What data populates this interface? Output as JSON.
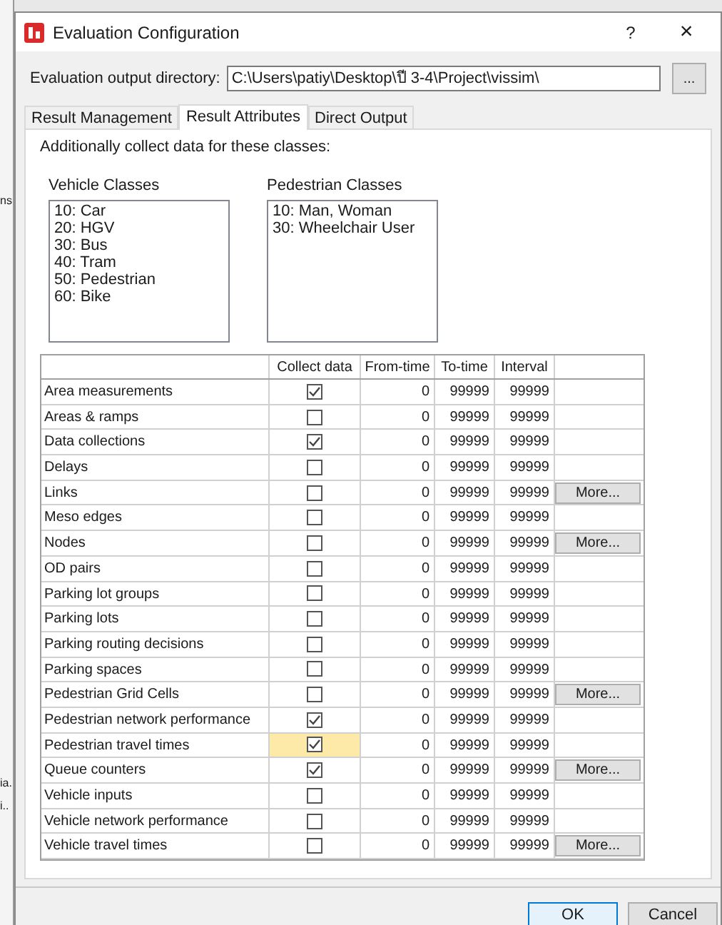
{
  "background_window": {
    "fragments": [
      "ns",
      "ia.",
      "i.."
    ]
  },
  "window": {
    "title": "Evaluation Configuration",
    "help": "?",
    "close": "×"
  },
  "output_directory": {
    "label": "Evaluation output directory:",
    "value": "C:\\Users\\patiy\\Desktop\\ปี 3-4\\Project\\vissim\\",
    "browse": "..."
  },
  "tabs": [
    {
      "label": "Result Management",
      "selected": false
    },
    {
      "label": "Result Attributes",
      "selected": true
    },
    {
      "label": "Direct Output",
      "selected": false
    }
  ],
  "intro": "Additionally collect data for these classes:",
  "vehicle_classes": {
    "title": "Vehicle Classes",
    "items": [
      "10: Car",
      "20: HGV",
      "30: Bus",
      "40: Tram",
      "50: Pedestrian",
      "60: Bike"
    ]
  },
  "pedestrian_classes": {
    "title": "Pedestrian Classes",
    "items": [
      "10: Man, Woman",
      "30: Wheelchair User"
    ]
  },
  "table": {
    "columns": [
      "Collect data",
      "From-time",
      "To-time",
      "Interval"
    ],
    "rows": [
      {
        "name": "Area measurements",
        "checked": true,
        "selected": false,
        "from": "0",
        "to": "99999",
        "interval": "99999"
      },
      {
        "name": "Areas & ramps",
        "checked": false,
        "selected": false,
        "from": "0",
        "to": "99999",
        "interval": "99999"
      },
      {
        "name": "Data collections",
        "checked": true,
        "selected": false,
        "from": "0",
        "to": "99999",
        "interval": "99999"
      },
      {
        "name": "Delays",
        "checked": false,
        "selected": false,
        "from": "0",
        "to": "99999",
        "interval": "99999"
      },
      {
        "name": "Links",
        "checked": false,
        "selected": false,
        "from": "0",
        "to": "99999",
        "interval": "99999",
        "more": "More..."
      },
      {
        "name": "Meso edges",
        "checked": false,
        "selected": false,
        "from": "0",
        "to": "99999",
        "interval": "99999"
      },
      {
        "name": "Nodes",
        "checked": false,
        "selected": false,
        "from": "0",
        "to": "99999",
        "interval": "99999",
        "more": "More..."
      },
      {
        "name": "OD pairs",
        "checked": false,
        "selected": false,
        "from": "0",
        "to": "99999",
        "interval": "99999"
      },
      {
        "name": "Parking lot groups",
        "checked": false,
        "selected": false,
        "from": "0",
        "to": "99999",
        "interval": "99999"
      },
      {
        "name": "Parking lots",
        "checked": false,
        "selected": false,
        "from": "0",
        "to": "99999",
        "interval": "99999"
      },
      {
        "name": "Parking routing decisions",
        "checked": false,
        "selected": false,
        "from": "0",
        "to": "99999",
        "interval": "99999"
      },
      {
        "name": "Parking spaces",
        "checked": false,
        "selected": false,
        "from": "0",
        "to": "99999",
        "interval": "99999"
      },
      {
        "name": "Pedestrian Grid Cells",
        "checked": false,
        "selected": false,
        "from": "0",
        "to": "99999",
        "interval": "99999",
        "more": "More..."
      },
      {
        "name": "Pedestrian network performance",
        "checked": true,
        "selected": false,
        "from": "0",
        "to": "99999",
        "interval": "99999"
      },
      {
        "name": "Pedestrian travel times",
        "checked": true,
        "selected": true,
        "from": "0",
        "to": "99999",
        "interval": "99999"
      },
      {
        "name": "Queue counters",
        "checked": true,
        "selected": false,
        "from": "0",
        "to": "99999",
        "interval": "99999",
        "more": "More..."
      },
      {
        "name": "Vehicle inputs",
        "checked": false,
        "selected": false,
        "from": "0",
        "to": "99999",
        "interval": "99999"
      },
      {
        "name": "Vehicle network performance",
        "checked": false,
        "selected": false,
        "from": "0",
        "to": "99999",
        "interval": "99999"
      },
      {
        "name": "Vehicle travel times",
        "checked": false,
        "selected": false,
        "from": "0",
        "to": "99999",
        "interval": "99999",
        "more": "More..."
      }
    ]
  },
  "buttons": [
    {
      "label": "OK",
      "default": true
    },
    {
      "label": "Cancel",
      "default": false
    }
  ]
}
